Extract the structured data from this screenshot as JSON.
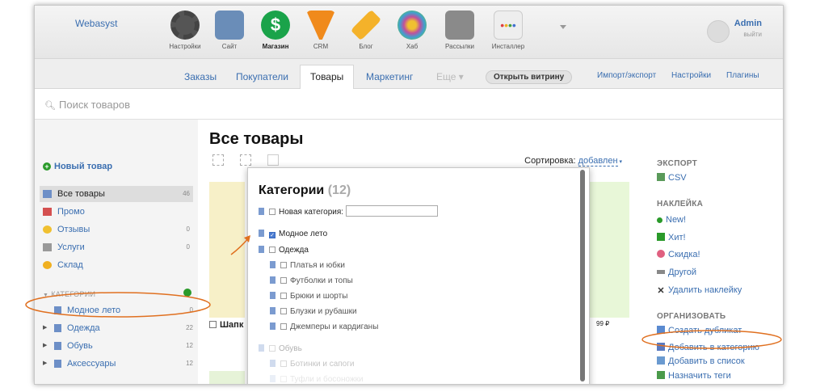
{
  "brand": "Webasyst",
  "apps": [
    {
      "label": "Настройки",
      "icon": "gear-icon",
      "color": "#555555"
    },
    {
      "label": "Сайт",
      "icon": "site-icon",
      "color": "#6a8db8"
    },
    {
      "label": "Магазин",
      "icon": "shop-icon",
      "color": "#1aa34a",
      "active": true
    },
    {
      "label": "CRM",
      "icon": "crm-funnel-icon",
      "color": "#f08a1c"
    },
    {
      "label": "Блог",
      "icon": "pencil-icon",
      "color": "#f4b22a"
    },
    {
      "label": "Хаб",
      "icon": "hub-icon",
      "color": "#c0509c"
    },
    {
      "label": "Рассылки",
      "icon": "mailer-icon",
      "color": "#8a8a8a"
    },
    {
      "label": "Инсталлер",
      "icon": "installer-icon",
      "color": "#eeeeee"
    }
  ],
  "user": {
    "name": "Admin",
    "logout": "выйти"
  },
  "tabs": [
    {
      "label": "Заказы"
    },
    {
      "label": "Покупатели"
    },
    {
      "label": "Товары",
      "active": true
    },
    {
      "label": "Маркетинг"
    },
    {
      "label": "Еще ▾",
      "dim": true
    }
  ],
  "open_storefront": "Открыть витрину",
  "right_links": [
    "Импорт/экспорт",
    "Настройки",
    "Плагины"
  ],
  "search": {
    "placeholder": "Поиск товаров"
  },
  "sidebar": {
    "new_product": "Новый товар",
    "items": [
      {
        "label": "Все товары",
        "count": "46",
        "icon": "all-products-icon"
      },
      {
        "label": "Промо",
        "count": "",
        "icon": "promo-icon"
      },
      {
        "label": "Отзывы",
        "count": "0",
        "icon": "reviews-icon"
      },
      {
        "label": "Услуги",
        "count": "0",
        "icon": "services-icon"
      },
      {
        "label": "Склад",
        "count": "",
        "icon": "stock-icon"
      }
    ],
    "categories_heading": "КАТЕГОРИИ",
    "categories": [
      {
        "label": "Модное лето",
        "count": "0",
        "expandable": false
      },
      {
        "label": "Одежда",
        "count": "22",
        "expandable": true
      },
      {
        "label": "Обувь",
        "count": "12",
        "expandable": true
      },
      {
        "label": "Аксессуары",
        "count": "12",
        "expandable": true
      }
    ]
  },
  "main": {
    "title": "Все товары",
    "sort_label": "Сортировка:",
    "sort_value": "добавлен",
    "product_label": "Шапк",
    "product_price": "99 ₽"
  },
  "right_panel": {
    "export_heading": "ЭКСПОРТ",
    "export_csv": "CSV",
    "badge_heading": "НАКЛЕЙКА",
    "badges": [
      "New!",
      "Хит!",
      "Скидка!",
      "Другой",
      "Удалить наклейку"
    ],
    "organize_heading": "ОРГАНИЗОВАТЬ",
    "organize": [
      "Создать дубликат",
      "Добавить в категорию",
      "Добавить в список",
      "Назначить теги"
    ]
  },
  "popup": {
    "title": "Категории",
    "count": "(12)",
    "new_category_label": "Новая категория:",
    "rows": [
      {
        "label": "Модное лето",
        "checked": true,
        "level": 0
      },
      {
        "label": "Одежда",
        "checked": false,
        "level": 0
      },
      {
        "label": "Платья и юбки",
        "checked": false,
        "level": 1
      },
      {
        "label": "Футболки и топы",
        "checked": false,
        "level": 1
      },
      {
        "label": "Брюки и шорты",
        "checked": false,
        "level": 1
      },
      {
        "label": "Блузки и рубашки",
        "checked": false,
        "level": 1
      },
      {
        "label": "Джемперы и кардиганы",
        "checked": false,
        "level": 1
      },
      {
        "label": "Обувь",
        "checked": false,
        "level": 0
      },
      {
        "label": "Ботинки и сапоги",
        "checked": false,
        "level": 1
      },
      {
        "label": "Туфли и босоножки",
        "checked": false,
        "level": 1
      }
    ]
  },
  "colors": {
    "link": "#3a6eb0",
    "annotation": "#e07020",
    "accent_green": "#2a9a2a"
  }
}
